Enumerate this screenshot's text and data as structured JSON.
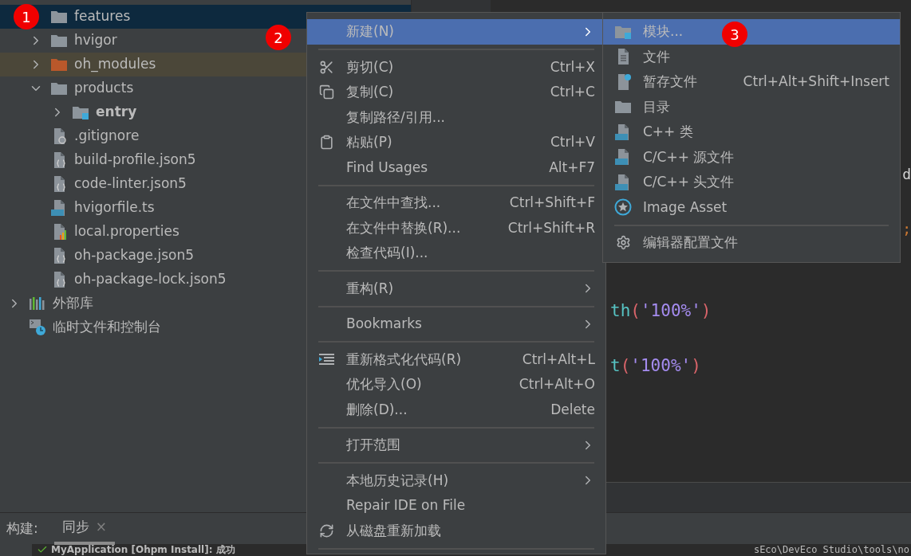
{
  "project_tree": {
    "items": [
      {
        "label": "features",
        "kind": "folder",
        "selected": true,
        "excluded": false
      },
      {
        "label": "hvigor",
        "kind": "folder",
        "expanded": false,
        "selected": false,
        "excluded": false
      },
      {
        "label": "oh_modules",
        "kind": "folder",
        "expanded": false,
        "selected": false,
        "excluded": true
      },
      {
        "label": "products",
        "kind": "folder",
        "expanded": true,
        "selected": false,
        "excluded": false,
        "children": [
          {
            "label": "entry",
            "kind": "module",
            "expanded": false,
            "selected": false,
            "excluded": false
          }
        ]
      },
      {
        "label": ".gitignore",
        "kind": "ignore-file",
        "selected": false,
        "excluded": false
      },
      {
        "label": "build-profile.json5",
        "kind": "json-file",
        "selected": false,
        "excluded": false
      },
      {
        "label": "code-linter.json5",
        "kind": "json-file",
        "selected": false,
        "excluded": false
      },
      {
        "label": "hvigorfile.ts",
        "kind": "ts-file",
        "selected": false,
        "excluded": false
      },
      {
        "label": "local.properties",
        "kind": "properties-file",
        "selected": false,
        "excluded": false
      },
      {
        "label": "oh-package.json5",
        "kind": "json-file",
        "selected": false,
        "excluded": false
      },
      {
        "label": "oh-package-lock.json5",
        "kind": "json-file",
        "selected": false,
        "excluded": false
      }
    ],
    "roots": [
      {
        "label": "外部库",
        "kind": "library",
        "expanded": false
      },
      {
        "label": "临时文件和控制台",
        "kind": "scratches"
      }
    ]
  },
  "editor": {
    "lines": [
      {
        "kind": "right",
        "tokens": [
          {
            "text": "d",
            "kind": "plain"
          }
        ]
      },
      {
        "kind": "blank"
      },
      {
        "kind": "right",
        "tokens": [
          {
            "text": ";",
            "kind": "punct"
          }
        ]
      },
      {
        "kind": "blank"
      },
      {
        "kind": "blank"
      },
      {
        "kind": "left",
        "tokens": [
          {
            "text": "th",
            "kind": "method"
          },
          {
            "text": "(",
            "kind": "paren"
          },
          {
            "text": "'100%'",
            "kind": "string"
          },
          {
            "text": ")",
            "kind": "paren"
          }
        ]
      },
      {
        "kind": "blank"
      },
      {
        "kind": "left",
        "tokens": [
          {
            "text": "t",
            "kind": "method"
          },
          {
            "text": "(",
            "kind": "paren"
          },
          {
            "text": "'100%'",
            "kind": "string"
          },
          {
            "text": ")",
            "kind": "paren"
          }
        ]
      }
    ]
  },
  "build_panel": {
    "label": "构建:",
    "tabs": [
      {
        "label": "同步",
        "close": "×",
        "selected": true
      }
    ],
    "tree_line": "MyApplication [Ohpm Install]: 成功",
    "log_line": "sEco\\DevEco Studio\\tools\\no"
  },
  "context_menu": {
    "items": [
      {
        "kind": "text",
        "label": "新建(N)",
        "selected": true,
        "submenu": true
      },
      {
        "kind": "separator"
      },
      {
        "kind": "cut",
        "label": "剪切(C)",
        "shortcut": "Ctrl+X",
        "selected": false,
        "submenu": false
      },
      {
        "kind": "copy",
        "label": "复制(C)",
        "shortcut": "Ctrl+C",
        "selected": false,
        "submenu": false
      },
      {
        "kind": "text",
        "label": "复制路径/引用...",
        "selected": false,
        "submenu": false
      },
      {
        "kind": "paste",
        "label": "粘贴(P)",
        "shortcut": "Ctrl+V",
        "selected": false,
        "submenu": false
      },
      {
        "kind": "text",
        "label": "Find Usages",
        "shortcut": "Alt+F7",
        "selected": false,
        "submenu": false
      },
      {
        "kind": "separator"
      },
      {
        "kind": "text",
        "label": "在文件中查找...",
        "shortcut": "Ctrl+Shift+F",
        "selected": false,
        "submenu": false
      },
      {
        "kind": "text",
        "label": "在文件中替换(R)...",
        "shortcut": "Ctrl+Shift+R",
        "selected": false,
        "submenu": false
      },
      {
        "kind": "text",
        "label": "检查代码(I)...",
        "selected": false,
        "submenu": false
      },
      {
        "kind": "separator"
      },
      {
        "kind": "text",
        "label": "重构(R)",
        "selected": false,
        "submenu": true
      },
      {
        "kind": "separator"
      },
      {
        "kind": "text",
        "label": "Bookmarks",
        "selected": false,
        "submenu": true
      },
      {
        "kind": "separator"
      },
      {
        "kind": "reformat",
        "label": "重新格式化代码(R)",
        "shortcut": "Ctrl+Alt+L",
        "selected": false,
        "submenu": false
      },
      {
        "kind": "text",
        "label": "优化导入(O)",
        "shortcut": "Ctrl+Alt+O",
        "selected": false,
        "submenu": false
      },
      {
        "kind": "text",
        "label": "删除(D)...",
        "shortcut": "Delete",
        "selected": false,
        "submenu": false
      },
      {
        "kind": "separator"
      },
      {
        "kind": "text",
        "label": "打开范围",
        "selected": false,
        "submenu": true
      },
      {
        "kind": "separator"
      },
      {
        "kind": "text",
        "label": "本地历史记录(H)",
        "selected": false,
        "submenu": true
      },
      {
        "kind": "text",
        "label": "Repair IDE on File",
        "selected": false,
        "submenu": false
      },
      {
        "kind": "reload",
        "label": "从磁盘重新加载",
        "selected": false,
        "submenu": false
      },
      {
        "kind": "separator"
      }
    ]
  },
  "submenu": {
    "items": [
      {
        "kind": "module",
        "label": "模块...",
        "selected": true
      },
      {
        "kind": "file",
        "label": "文件",
        "selected": false
      },
      {
        "kind": "scratch",
        "label": "暂存文件",
        "shortcut": "Ctrl+Alt+Shift+Insert",
        "selected": false
      },
      {
        "kind": "directory",
        "label": "目录",
        "selected": false
      },
      {
        "kind": "cpp-class",
        "label": "C++ 类",
        "selected": false
      },
      {
        "kind": "c-source",
        "label": "C/C++ 源文件",
        "selected": false
      },
      {
        "kind": "c-header",
        "label": "C/C++ 头文件",
        "selected": false
      },
      {
        "kind": "image-asset",
        "label": "Image Asset",
        "selected": false
      },
      {
        "kind": "separator"
      },
      {
        "kind": "settings",
        "label": "编辑器配置文件",
        "selected": false
      }
    ]
  },
  "annotations": [
    {
      "label": "1"
    },
    {
      "label": "2"
    },
    {
      "label": "3"
    }
  ]
}
